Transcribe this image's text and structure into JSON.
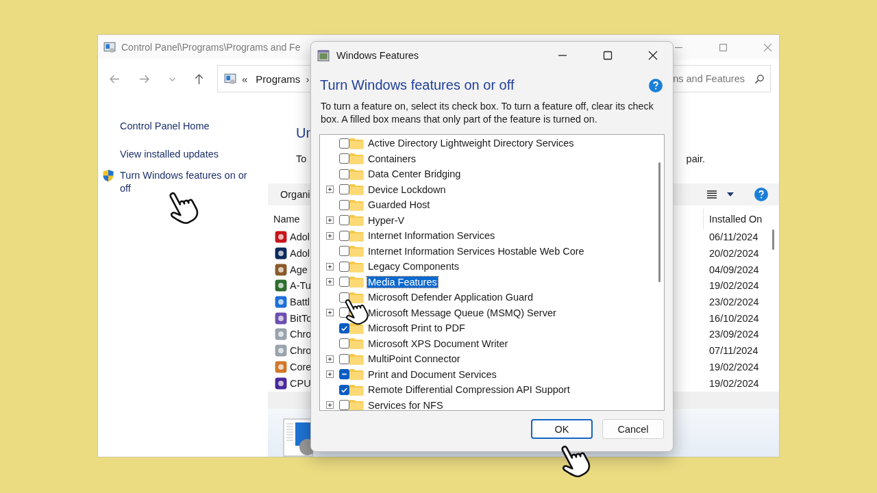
{
  "window": {
    "title": "Control Panel\\Programs\\Programs and Fe"
  },
  "address_bar": {
    "chevron": "«",
    "location": "Programs",
    "separator": "›"
  },
  "search": {
    "placeholder": "ns and Features"
  },
  "sidebar": {
    "links": [
      {
        "label": "Control Panel Home",
        "shield": false
      },
      {
        "label": "View installed updates",
        "shield": false
      },
      {
        "label": "Turn Windows features on or off",
        "shield": true
      }
    ]
  },
  "content": {
    "heading": "Un",
    "text": "To",
    "text_end": "pair.",
    "organize": "Organi",
    "columns": [
      "Name",
      "Installed On"
    ],
    "programs": [
      {
        "name": "Adol",
        "installed_on": "06/11/2024"
      },
      {
        "name": "Adol",
        "installed_on": "20/02/2024"
      },
      {
        "name": "Age",
        "installed_on": "04/09/2024"
      },
      {
        "name": "A-Tu",
        "installed_on": "19/02/2024"
      },
      {
        "name": "Battl",
        "installed_on": "23/02/2024"
      },
      {
        "name": "BitTo",
        "installed_on": "16/10/2024"
      },
      {
        "name": "Chro",
        "installed_on": "23/09/2024"
      },
      {
        "name": "Chro",
        "installed_on": "07/11/2024"
      },
      {
        "name": "Core",
        "installed_on": "19/02/2024"
      },
      {
        "name": "CPU",
        "installed_on": "19/02/2024"
      }
    ]
  },
  "dialog": {
    "title": "Windows Features",
    "heading": "Turn Windows features on or off",
    "description": "To turn a feature on, select its check box. To turn a feature off, clear its check box. A filled box means that only part of the feature is turned on.",
    "features": [
      {
        "label": "Active Directory Lightweight Directory Services",
        "expandable": false,
        "checked": false,
        "partial": false,
        "selected": false
      },
      {
        "label": "Containers",
        "expandable": false,
        "checked": false,
        "partial": false,
        "selected": false
      },
      {
        "label": "Data Center Bridging",
        "expandable": false,
        "checked": false,
        "partial": false,
        "selected": false
      },
      {
        "label": "Device Lockdown",
        "expandable": true,
        "checked": false,
        "partial": false,
        "selected": false
      },
      {
        "label": "Guarded Host",
        "expandable": false,
        "checked": false,
        "partial": false,
        "selected": false
      },
      {
        "label": "Hyper-V",
        "expandable": true,
        "checked": false,
        "partial": false,
        "selected": false
      },
      {
        "label": "Internet Information Services",
        "expandable": true,
        "checked": false,
        "partial": false,
        "selected": false
      },
      {
        "label": "Internet Information Services Hostable Web Core",
        "expandable": false,
        "checked": false,
        "partial": false,
        "selected": false
      },
      {
        "label": "Legacy Components",
        "expandable": true,
        "checked": false,
        "partial": false,
        "selected": false
      },
      {
        "label": "Media Features",
        "expandable": true,
        "checked": false,
        "partial": false,
        "selected": true
      },
      {
        "label": "Microsoft Defender Application Guard",
        "expandable": false,
        "checked": false,
        "partial": false,
        "selected": false
      },
      {
        "label": "Microsoft Message Queue (MSMQ) Server",
        "expandable": true,
        "checked": false,
        "partial": false,
        "selected": false
      },
      {
        "label": "Microsoft Print to PDF",
        "expandable": false,
        "checked": true,
        "partial": false,
        "selected": false
      },
      {
        "label": "Microsoft XPS Document Writer",
        "expandable": false,
        "checked": false,
        "partial": false,
        "selected": false
      },
      {
        "label": "MultiPoint Connector",
        "expandable": true,
        "checked": false,
        "partial": false,
        "selected": false
      },
      {
        "label": "Print and Document Services",
        "expandable": true,
        "checked": false,
        "partial": true,
        "selected": false
      },
      {
        "label": "Remote Differential Compression API Support",
        "expandable": false,
        "checked": true,
        "partial": false,
        "selected": false
      },
      {
        "label": "Services for NFS",
        "expandable": true,
        "checked": false,
        "partial": false,
        "selected": false
      }
    ],
    "buttons": [
      {
        "label": "OK",
        "default": true
      },
      {
        "label": "Cancel",
        "default": false
      }
    ]
  }
}
